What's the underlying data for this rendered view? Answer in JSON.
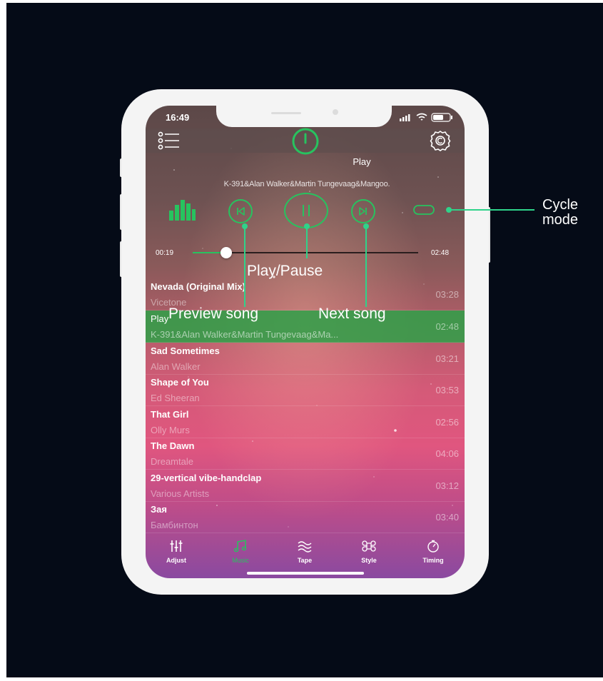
{
  "status": {
    "time": "16:49"
  },
  "now_playing": {
    "title": "Play",
    "artist": "K-391&Alan Walker&Martin Tungevaag&Mangoo.",
    "elapsed": "00:19",
    "total": "02:48",
    "progress": 0.15
  },
  "songs": [
    {
      "title": "Nevada (Original Mix)",
      "artist": "Vicetone",
      "duration": "03:28",
      "active": false
    },
    {
      "title": "Play",
      "artist": "K-391&Alan Walker&Martin Tungevaag&Ma...",
      "duration": "02:48",
      "active": true
    },
    {
      "title": "Sad Sometimes",
      "artist": "Alan Walker",
      "duration": "03:21",
      "active": false
    },
    {
      "title": "Shape of You",
      "artist": "Ed Sheeran",
      "duration": "03:53",
      "active": false
    },
    {
      "title": "That Girl",
      "artist": "Olly Murs",
      "duration": "02:56",
      "active": false
    },
    {
      "title": "The Dawn",
      "artist": "Dreamtale",
      "duration": "04:06",
      "active": false
    },
    {
      "title": "29-vertical vibe-handclap",
      "artist": "Various Artists",
      "duration": "03:12",
      "active": false
    },
    {
      "title": "Зая",
      "artist": "Бамбинтон",
      "duration": "03:40",
      "active": false
    }
  ],
  "tabs": [
    {
      "label": "Adjust",
      "icon": "sliders-icon",
      "active": false
    },
    {
      "label": "Music",
      "icon": "music-note-icon",
      "active": true
    },
    {
      "label": "Tape",
      "icon": "tape-waves-icon",
      "active": false
    },
    {
      "label": "Style",
      "icon": "command-icon",
      "active": false
    },
    {
      "label": "Timing",
      "icon": "timer-icon",
      "active": false
    }
  ],
  "annotations": {
    "cycle_line1": "Cycle",
    "cycle_line2": "mode",
    "play_pause": "Play/Pause",
    "preview": "Preview song",
    "next": "Next song"
  },
  "colors": {
    "accent": "#27c35f",
    "annotation": "#2fd38a",
    "background": "#050b17"
  }
}
